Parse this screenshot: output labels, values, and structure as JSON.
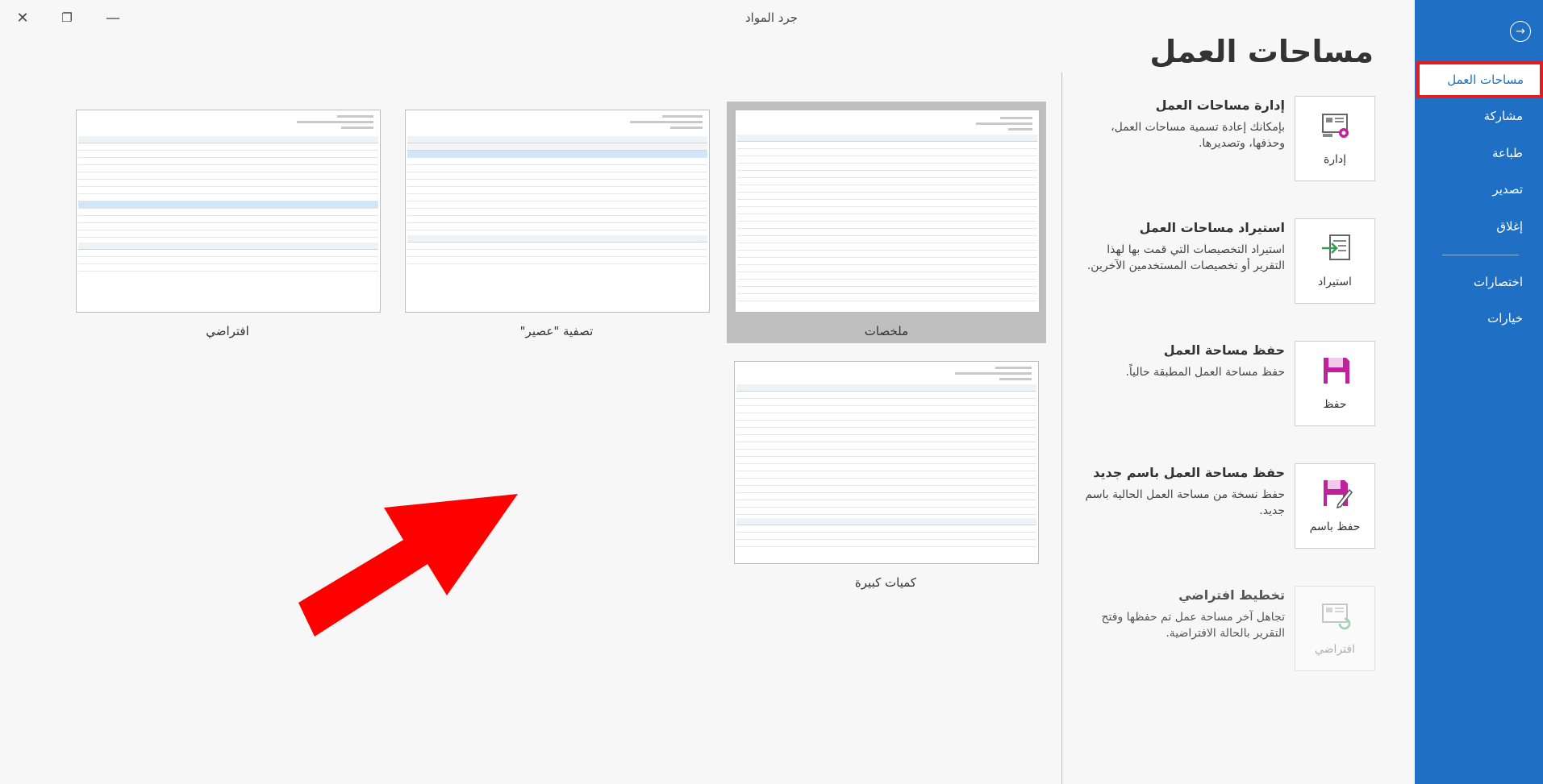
{
  "window": {
    "title": "جرد المواد",
    "close_icon": "close-icon",
    "restore_icon": "restore-icon",
    "minimize_icon": "minimize-icon"
  },
  "sidebar": {
    "back_icon": "back-arrow-icon",
    "items": [
      {
        "label": "مساحات العمل",
        "active": true
      },
      {
        "label": "مشاركة"
      },
      {
        "label": "طباعة"
      },
      {
        "label": "تصدير"
      },
      {
        "label": "إغلاق"
      },
      {
        "label": "اختصارات"
      },
      {
        "label": "خيارات"
      }
    ],
    "accent": "#1f6fc4",
    "highlight": "#e31b23"
  },
  "page": {
    "title": "مساحات العمل"
  },
  "actions": [
    {
      "tile": "إدارة",
      "icon": "manage-workspace-icon",
      "title": "إدارة مساحات العمل",
      "desc": "بإمكانك إعادة تسمية مساحات العمل، وحذفها، وتصديرها.",
      "enabled": true
    },
    {
      "tile": "استيراد",
      "icon": "import-icon",
      "title": "استيراد مساحات العمل",
      "desc": "استيراد التخصيصات التي قمت بها لهذا التقرير أو تخصيصات المستخدمين الآخرين.",
      "enabled": true
    },
    {
      "tile": "حفظ",
      "icon": "save-icon",
      "title": "حفظ مساحة العمل",
      "desc": "حفظ مساحة العمل المطبقة حالياً.",
      "enabled": true
    },
    {
      "tile": "حفظ باسم",
      "icon": "save-as-icon",
      "title": "حفظ مساحة العمل باسم جديد",
      "desc": "حفظ نسخة من مساحة العمل الحالية باسم جديد.",
      "enabled": true
    },
    {
      "tile": "افتراضي",
      "icon": "default-layout-icon",
      "title": "تخطيط افتراضي",
      "desc": "تجاهل آخر مساحة عمل تم حفظها وفتح التقرير بالحالة الافتراضية.",
      "enabled": false
    }
  ],
  "workspaces": [
    {
      "label": "ملخصات",
      "selected": true
    },
    {
      "label": "تصفية \"عصير\""
    },
    {
      "label": "افتراضي"
    },
    {
      "label": "كميات كبيرة"
    }
  ],
  "annotation": {
    "icon": "red-arrow-icon",
    "color": "#ff0000"
  }
}
